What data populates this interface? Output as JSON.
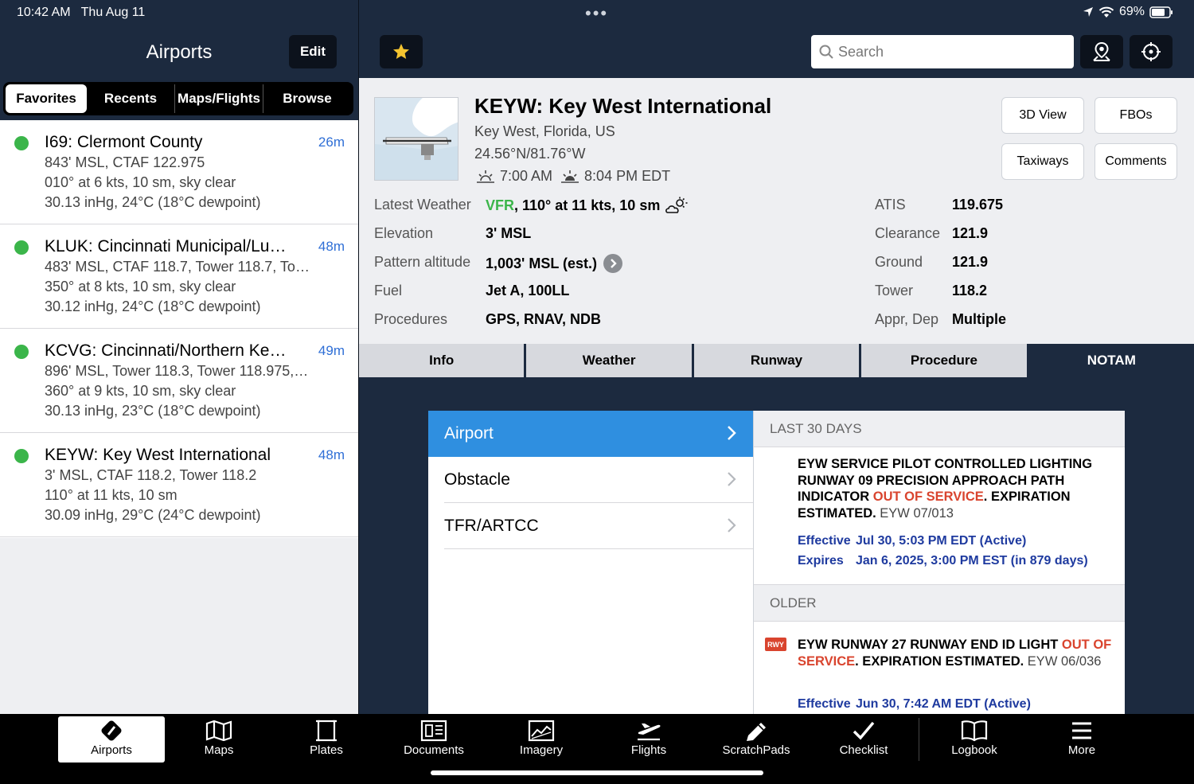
{
  "status": {
    "time": "10:42 AM   Thu Aug 11",
    "battery": "69%"
  },
  "left": {
    "title": "Airports",
    "edit": "Edit",
    "segments": [
      "Favorites",
      "Recents",
      "Maps/Flights",
      "Browse"
    ],
    "favorites": [
      {
        "name": "I69: Clermont County",
        "time": "26m",
        "l1": "843' MSL, CTAF 122.975",
        "l2": "010° at 6 kts, 10 sm, sky clear",
        "l3": "30.13 inHg, 24°C (18°C dewpoint)"
      },
      {
        "name": "KLUK: Cincinnati Municipal/Lu…",
        "time": "48m",
        "l1": "483' MSL, CTAF 118.7, Tower 118.7, To…",
        "l2": "350° at 8 kts, 10 sm, sky clear",
        "l3": "30.12 inHg, 24°C (18°C dewpoint)"
      },
      {
        "name": "KCVG: Cincinnati/Northern Ke…",
        "time": "49m",
        "l1": "896' MSL, Tower 118.3, Tower 118.975,…",
        "l2": "360° at 9 kts, 10 sm, sky clear",
        "l3": "30.13 inHg, 23°C (18°C dewpoint)"
      },
      {
        "name": "KEYW: Key West International",
        "time": "48m",
        "l1": "3' MSL, CTAF 118.2, Tower 118.2",
        "l2": "110° at 11 kts, 10 sm",
        "l3": "30.09 inHg, 29°C (24°C dewpoint)"
      }
    ]
  },
  "header": {
    "search_placeholder": "Search"
  },
  "airport": {
    "title": "KEYW: Key West International",
    "location": "Key West, Florida, US",
    "coords": "24.56°N/81.76°W",
    "sunrise": "7:00 AM",
    "sunset": "8:04 PM EDT",
    "buttons": {
      "view3d": "3D View",
      "fbos": "FBOs",
      "taxiways": "Taxiways",
      "comments": "Comments"
    },
    "details": {
      "weather_label": "Latest Weather",
      "weather_cat": "VFR",
      "weather_rest": ", 110° at 11 kts, 10 sm",
      "elevation_label": "Elevation",
      "elevation": "3' MSL",
      "pattern_label": "Pattern altitude",
      "pattern": "1,003' MSL (est.)",
      "fuel_label": "Fuel",
      "fuel": "Jet A, 100LL",
      "procedures_label": "Procedures",
      "procedures": "GPS, RNAV, NDB"
    },
    "freqs": [
      {
        "label": "ATIS",
        "value": "119.675"
      },
      {
        "label": "Clearance",
        "value": "121.9"
      },
      {
        "label": "Ground",
        "value": "121.9"
      },
      {
        "label": "Tower",
        "value": "118.2"
      },
      {
        "label": "Appr, Dep",
        "value": "Multiple"
      }
    ]
  },
  "tabs": [
    "Info",
    "Weather",
    "Runway",
    "Procedure",
    "NOTAM"
  ],
  "notam": {
    "categories": [
      "Airport",
      "Obstacle",
      "TFR/ARTCC"
    ],
    "last30_header": "LAST 30 DAYS",
    "older_header": "OLDER",
    "n1": {
      "pre": "EYW SERVICE PILOT CONTROLLED LIGHTING RUNWAY 09 PRECISION APPROACH PATH INDICATOR ",
      "oos": "OUT OF SERVICE",
      "post": ". EXPIRATION ESTIMATED.",
      "id": " EYW 07/013",
      "effective_label": "Effective",
      "effective": "Jul 30, 5:03 PM EDT (Active)",
      "expires_label": "Expires",
      "expires": "Jan 6, 2025, 3:00 PM EST (in 879 days)"
    },
    "n2": {
      "badge": "RWY",
      "pre": "EYW RUNWAY 27 RUNWAY END ID LIGHT ",
      "oos": "OUT OF SERVICE",
      "post": ". EXPIRATION ESTIMATED.",
      "id": " EYW 06/036",
      "effective_label": "Effective",
      "effective": "Jun 30, 7:42 AM EDT (Active)"
    }
  },
  "bottom": [
    "Airports",
    "Maps",
    "Plates",
    "Documents",
    "Imagery",
    "Flights",
    "ScratchPads",
    "Checklist",
    "Logbook",
    "More"
  ],
  "colors": {
    "navy": "#1c2a3f",
    "accent_blue": "#2f8fe0",
    "vfr_green": "#3bb54a",
    "oos_red": "#d9442e",
    "star": "#f4c430"
  }
}
